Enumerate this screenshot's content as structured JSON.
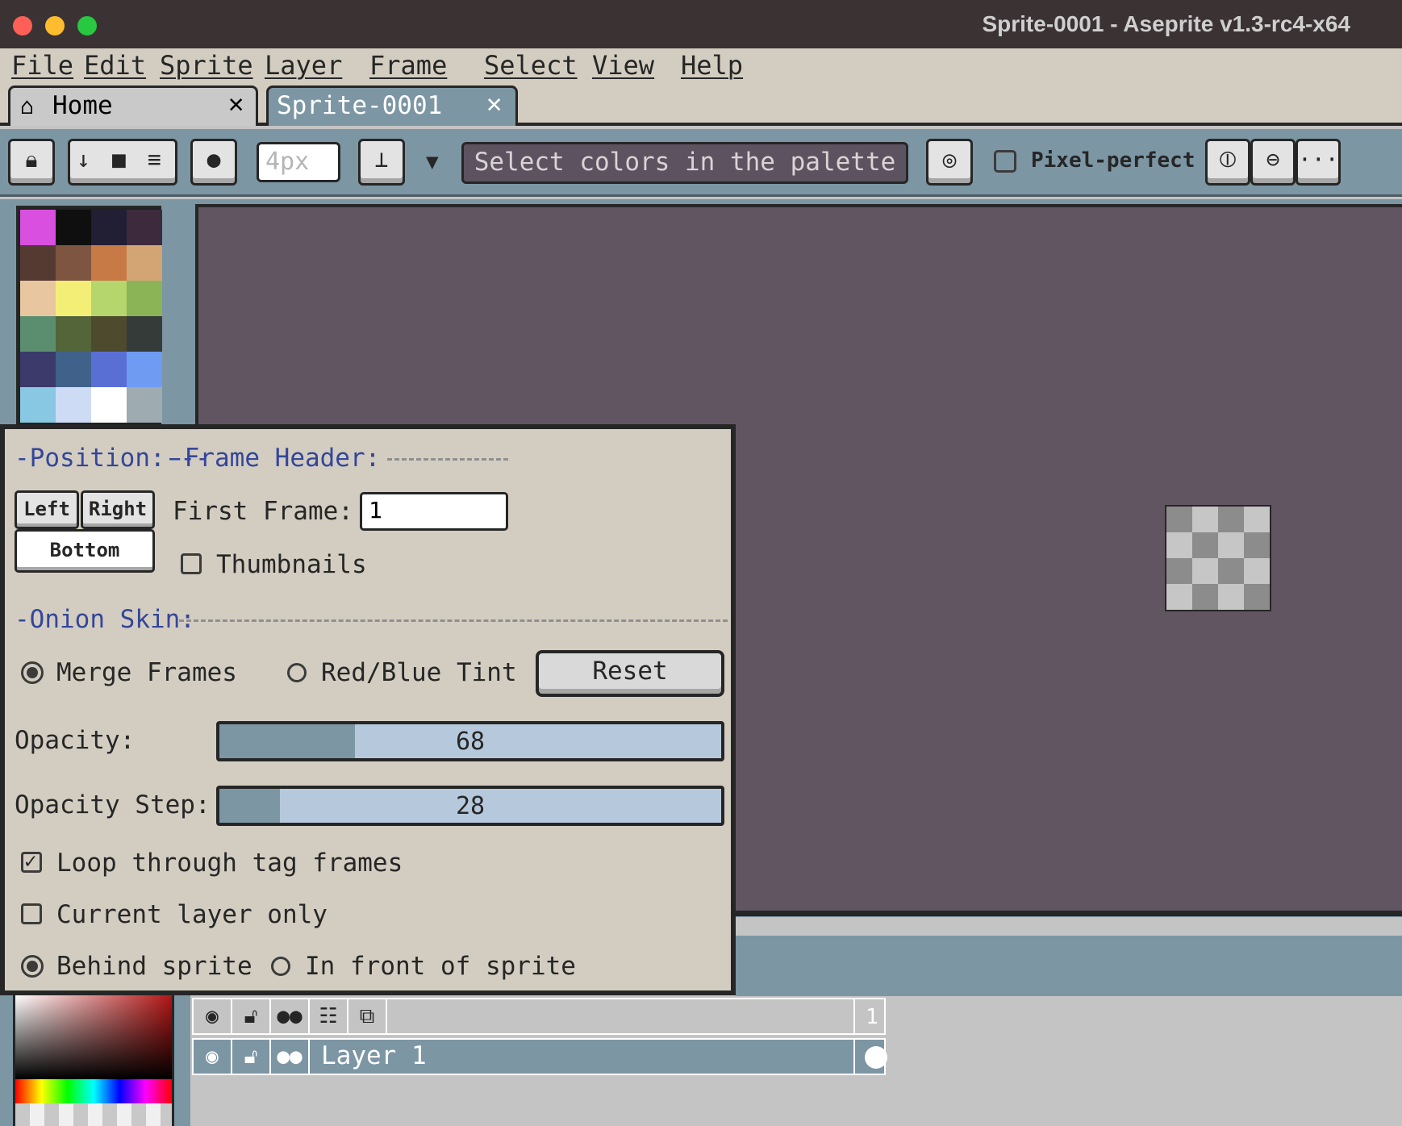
{
  "window": {
    "title": "Sprite-0001 - Aseprite v1.3-rc4-x64"
  },
  "menu": [
    "File",
    "Edit",
    "Sprite",
    "Layer",
    "Frame",
    "Select",
    "View",
    "Help"
  ],
  "tabs": {
    "home": "Home",
    "sprite": "Sprite-0001",
    "close_glyph": "✕"
  },
  "toolbar": {
    "brush_size_placeholder": "4px",
    "ink_select": "Select colors in the palette",
    "pixel_perfect_label": "Pixel-perfect",
    "more_label": "···"
  },
  "palette": {
    "colors": [
      "#d94fe0",
      "#0f0f0f",
      "#221e33",
      "#3d2a3d",
      "#553a32",
      "#7d5540",
      "#c77a45",
      "#d4a574",
      "#e8c7a0",
      "#f3ef76",
      "#b5d56d",
      "#8bb456",
      "#5a8e6e",
      "#54653a",
      "#4e4a2d",
      "#353b38",
      "#3c3a6b",
      "#40618a",
      "#5a6fd4",
      "#6f9cf2",
      "#88c8e2",
      "#cddbf5",
      "#ffffff",
      "#9eabb0"
    ]
  },
  "onion_dialog": {
    "position_header": "Position:",
    "frame_header_title": "Frame Header:",
    "left_button": "Left",
    "right_button": "Right",
    "bottom_button": "Bottom",
    "first_frame_label": "First Frame:",
    "first_frame_value": "1",
    "thumbnails_label": "Thumbnails",
    "onion_skin_header": "Onion Skin:",
    "merge_frames_label": "Merge Frames",
    "red_blue_tint_label": "Red/Blue Tint",
    "reset_label": "Reset",
    "opacity_label": "Opacity:",
    "opacity_value": "68",
    "opacity_fraction": 0.27,
    "opacity_step_label": "Opacity Step:",
    "opacity_step_value": "28",
    "opacity_step_fraction": 0.12,
    "loop_label": "Loop through tag frames",
    "current_layer_label": "Current layer only",
    "behind_label": "Behind sprite",
    "in_front_label": "In front of sprite"
  },
  "timeline": {
    "frame_number": "1",
    "layer_name": "Layer 1"
  }
}
